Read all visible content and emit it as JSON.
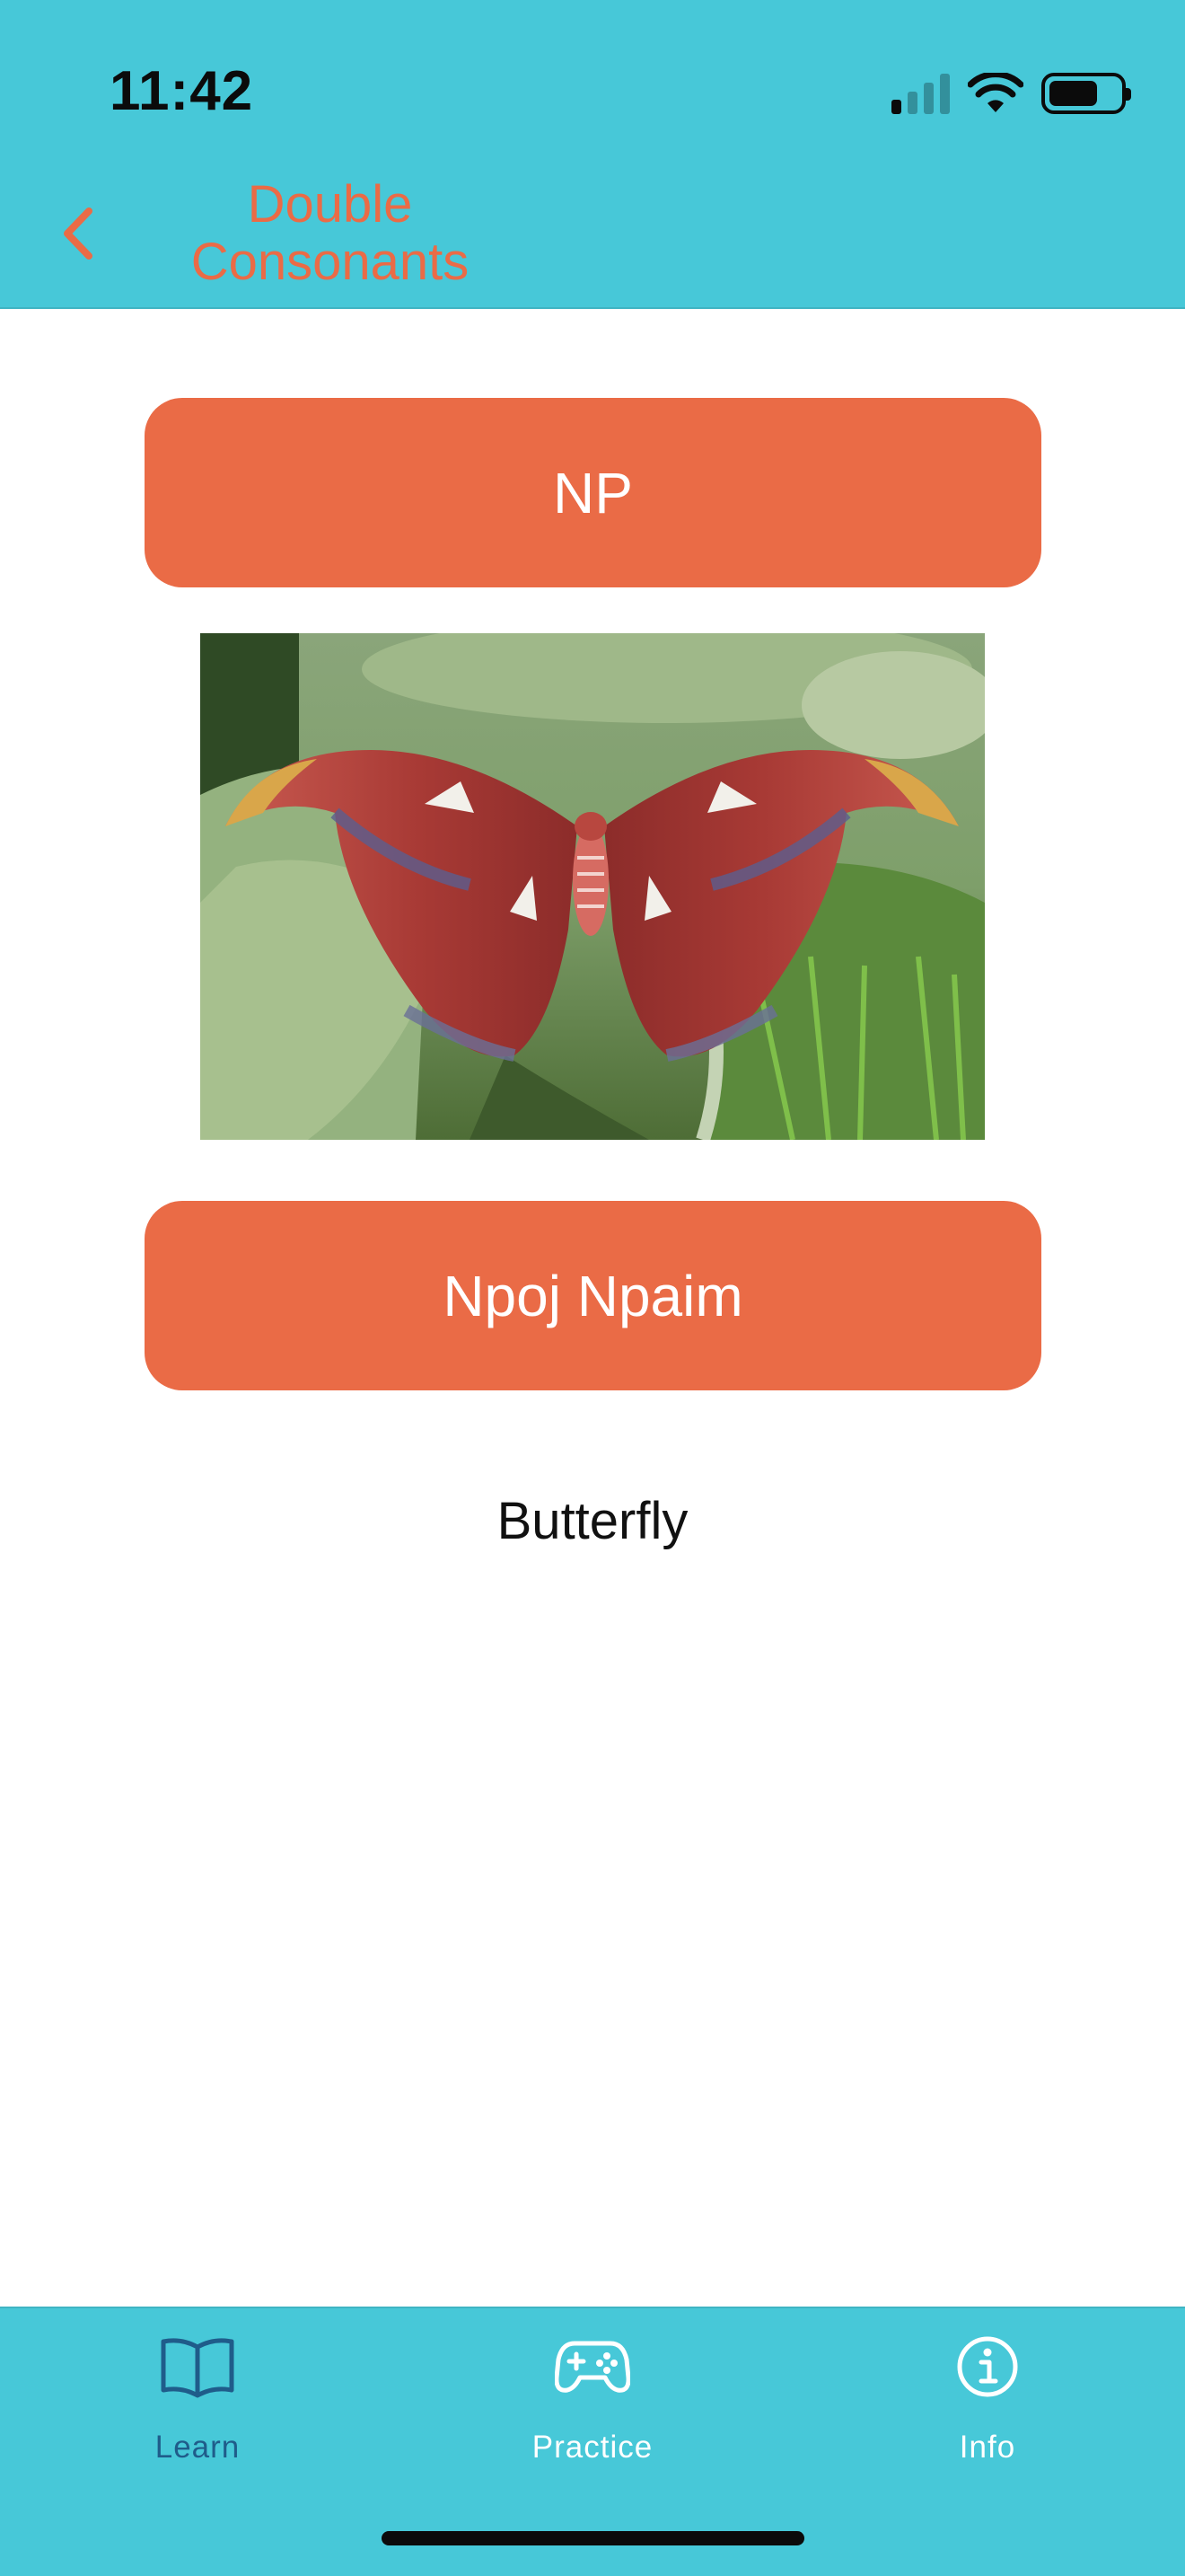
{
  "status_bar": {
    "time": "11:42"
  },
  "nav": {
    "title": "Double Consonants",
    "back_icon": "chevron-left-icon"
  },
  "card": {
    "consonant_label": "NP",
    "image_subject": "moth-photo",
    "word_label": "Npoj Npaim",
    "translation": "Butterfly"
  },
  "tabbar": {
    "tabs": [
      {
        "label": "Learn",
        "icon": "book-icon",
        "active": true
      },
      {
        "label": "Practice",
        "icon": "gamepad-icon",
        "active": false
      },
      {
        "label": "Info",
        "icon": "info-icon",
        "active": false
      }
    ]
  },
  "colors": {
    "accent": "#ea6b46",
    "bar_background": "#47c8d8",
    "active_tab": "#1f5c8a",
    "inactive_tab": "#ffffff"
  }
}
